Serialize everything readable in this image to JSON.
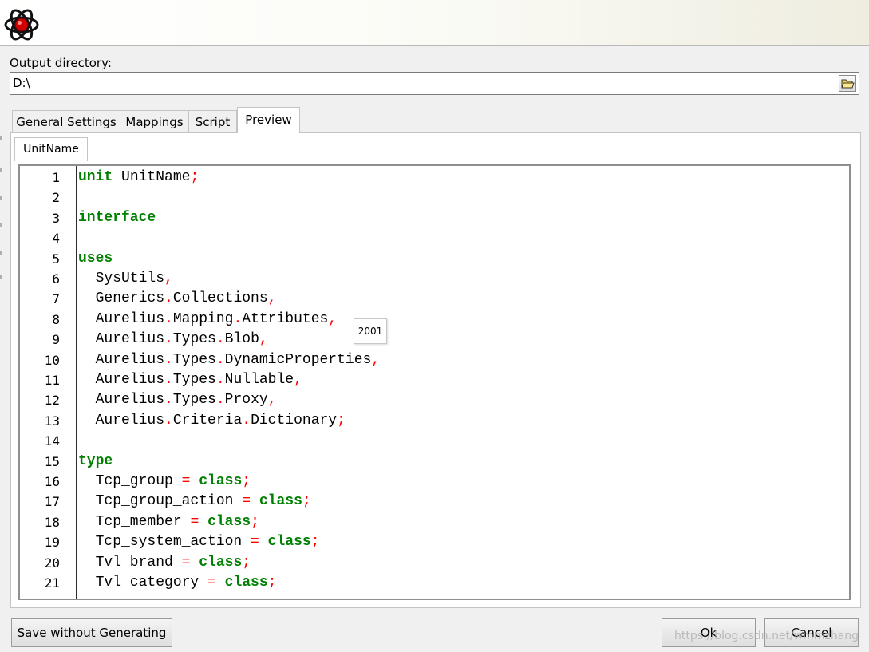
{
  "app": {
    "icon": "red-atom-icon"
  },
  "output": {
    "label": "Output directory:",
    "value": "D:\\",
    "browse_icon": "folder-open-icon"
  },
  "tabs": [
    "General Settings",
    "Mappings",
    "Script",
    "Preview"
  ],
  "active_tab": "Preview",
  "subtab": "UnitName",
  "code_lines": [
    {
      "n": "1",
      "parts": [
        [
          "kw",
          "unit"
        ],
        [
          "t",
          " UnitName"
        ],
        [
          "sym",
          ";"
        ]
      ]
    },
    {
      "n": "2",
      "parts": []
    },
    {
      "n": "3",
      "parts": [
        [
          "kw",
          "interface"
        ]
      ]
    },
    {
      "n": "4",
      "parts": []
    },
    {
      "n": "5",
      "parts": [
        [
          "kw",
          "uses"
        ]
      ]
    },
    {
      "n": "6",
      "parts": [
        [
          "t",
          "  SysUtils"
        ],
        [
          "sym",
          ","
        ]
      ]
    },
    {
      "n": "7",
      "parts": [
        [
          "t",
          "  Generics"
        ],
        [
          "sym",
          "."
        ],
        [
          "t",
          "Collections"
        ],
        [
          "sym",
          ","
        ]
      ]
    },
    {
      "n": "8",
      "parts": [
        [
          "t",
          "  Aurelius"
        ],
        [
          "sym",
          "."
        ],
        [
          "t",
          "Mapping"
        ],
        [
          "sym",
          "."
        ],
        [
          "t",
          "Attributes"
        ],
        [
          "sym",
          ","
        ]
      ]
    },
    {
      "n": "9",
      "parts": [
        [
          "t",
          "  Aurelius"
        ],
        [
          "sym",
          "."
        ],
        [
          "t",
          "Types"
        ],
        [
          "sym",
          "."
        ],
        [
          "t",
          "Blob"
        ],
        [
          "sym",
          ","
        ]
      ]
    },
    {
      "n": "10",
      "parts": [
        [
          "t",
          "  Aurelius"
        ],
        [
          "sym",
          "."
        ],
        [
          "t",
          "Types"
        ],
        [
          "sym",
          "."
        ],
        [
          "t",
          "DynamicProperties"
        ],
        [
          "sym",
          ","
        ]
      ]
    },
    {
      "n": "11",
      "parts": [
        [
          "t",
          "  Aurelius"
        ],
        [
          "sym",
          "."
        ],
        [
          "t",
          "Types"
        ],
        [
          "sym",
          "."
        ],
        [
          "t",
          "Nullable"
        ],
        [
          "sym",
          ","
        ]
      ]
    },
    {
      "n": "12",
      "parts": [
        [
          "t",
          "  Aurelius"
        ],
        [
          "sym",
          "."
        ],
        [
          "t",
          "Types"
        ],
        [
          "sym",
          "."
        ],
        [
          "t",
          "Proxy"
        ],
        [
          "sym",
          ","
        ]
      ]
    },
    {
      "n": "13",
      "parts": [
        [
          "t",
          "  Aurelius"
        ],
        [
          "sym",
          "."
        ],
        [
          "t",
          "Criteria"
        ],
        [
          "sym",
          "."
        ],
        [
          "t",
          "Dictionary"
        ],
        [
          "sym",
          ";"
        ]
      ]
    },
    {
      "n": "14",
      "parts": []
    },
    {
      "n": "15",
      "parts": [
        [
          "kw",
          "type"
        ]
      ]
    },
    {
      "n": "16",
      "parts": [
        [
          "t",
          "  Tcp_group "
        ],
        [
          "sym",
          "="
        ],
        [
          "t",
          " "
        ],
        [
          "kw",
          "class"
        ],
        [
          "sym",
          ";"
        ]
      ]
    },
    {
      "n": "17",
      "parts": [
        [
          "t",
          "  Tcp_group_action "
        ],
        [
          "sym",
          "="
        ],
        [
          "t",
          " "
        ],
        [
          "kw",
          "class"
        ],
        [
          "sym",
          ";"
        ]
      ]
    },
    {
      "n": "18",
      "parts": [
        [
          "t",
          "  Tcp_member "
        ],
        [
          "sym",
          "="
        ],
        [
          "t",
          " "
        ],
        [
          "kw",
          "class"
        ],
        [
          "sym",
          ";"
        ]
      ]
    },
    {
      "n": "19",
      "parts": [
        [
          "t",
          "  Tcp_system_action "
        ],
        [
          "sym",
          "="
        ],
        [
          "t",
          " "
        ],
        [
          "kw",
          "class"
        ],
        [
          "sym",
          ";"
        ]
      ]
    },
    {
      "n": "20",
      "parts": [
        [
          "t",
          "  Tvl_brand "
        ],
        [
          "sym",
          "="
        ],
        [
          "t",
          " "
        ],
        [
          "kw",
          "class"
        ],
        [
          "sym",
          ";"
        ]
      ]
    },
    {
      "n": "21",
      "parts": [
        [
          "t",
          "  Tvl_category "
        ],
        [
          "sym",
          "="
        ],
        [
          "t",
          " "
        ],
        [
          "kw",
          "class"
        ],
        [
          "sym",
          ";"
        ]
      ]
    }
  ],
  "tooltip": "2001",
  "buttons": {
    "save": "Save without Generating",
    "ok": "Ok",
    "cancel": "Cancel"
  },
  "watermark": "https://blog.csdn.net/wmmzhang",
  "colors": {
    "keyword": "#008000",
    "symbol": "#ff0000",
    "text": "#000000"
  }
}
